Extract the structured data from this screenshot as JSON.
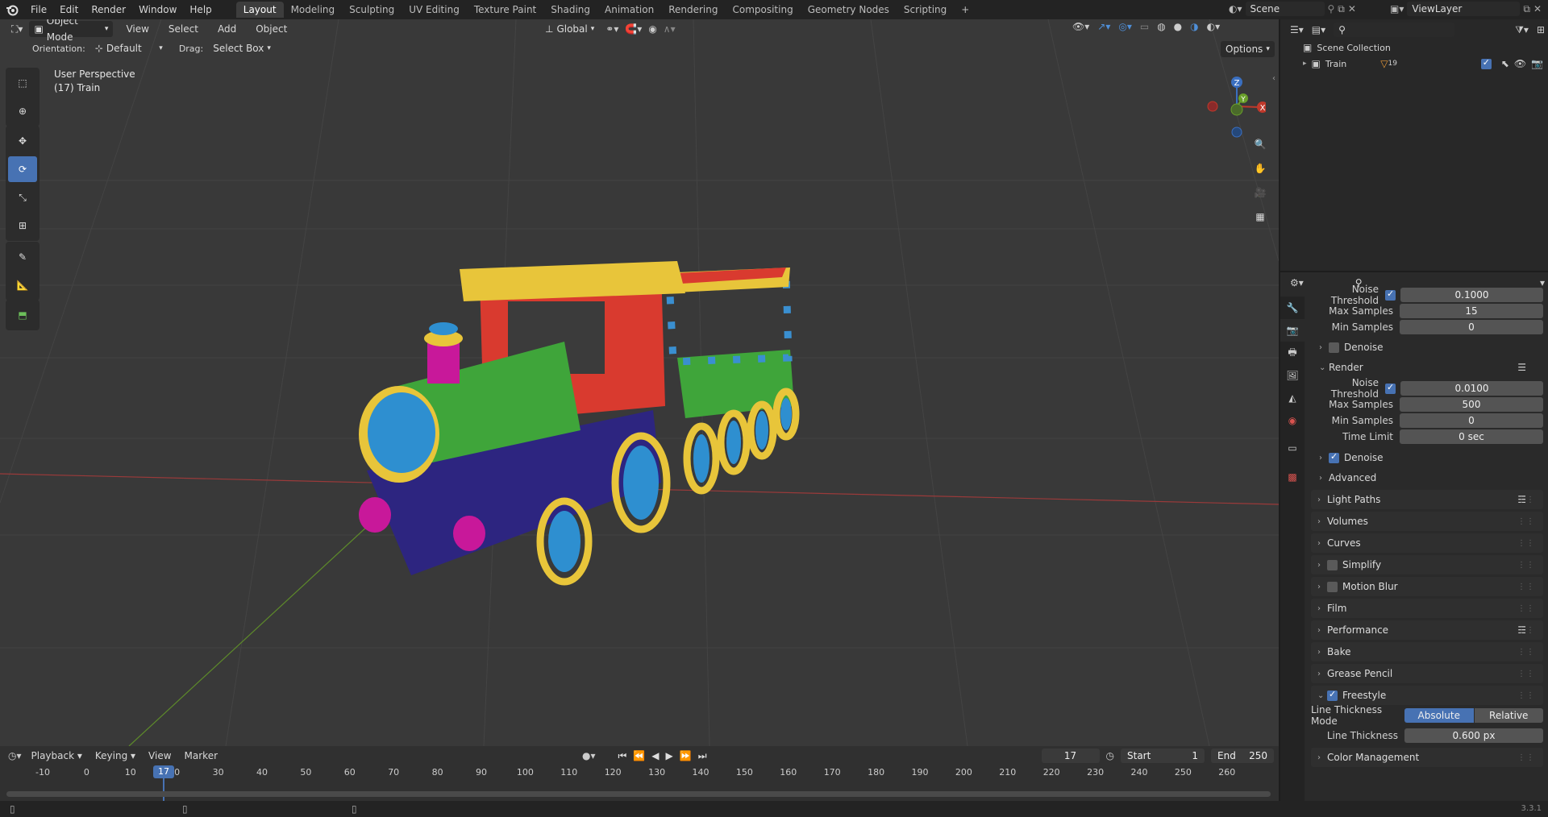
{
  "topbar": {
    "menus": [
      "File",
      "Edit",
      "Render",
      "Window",
      "Help"
    ],
    "workspaces": [
      "Layout",
      "Modeling",
      "Sculpting",
      "UV Editing",
      "Texture Paint",
      "Shading",
      "Animation",
      "Rendering",
      "Compositing",
      "Geometry Nodes",
      "Scripting"
    ],
    "active_workspace": "Layout",
    "add_tab": "+",
    "scene_name": "Scene",
    "view_layer": "ViewLayer"
  },
  "viewport_header": {
    "mode": "Object Mode",
    "menus": [
      "View",
      "Select",
      "Add",
      "Object"
    ],
    "transform_orientation": "Global",
    "orientation_label": "Orientation:",
    "orientation_value": "Default",
    "drag_label": "Drag:",
    "drag_value": "Select Box",
    "options": "Options"
  },
  "viewport": {
    "perspective": "User Perspective",
    "object_info": "(17) Train",
    "gizmo": {
      "z": "Z",
      "y": "Y",
      "x": "X"
    }
  },
  "outliner": {
    "collection": "Scene Collection",
    "item": "Train",
    "item_badge": "19"
  },
  "properties": {
    "viewport_noise_threshold_label": "Noise Threshold",
    "viewport_noise_threshold": "0.1000",
    "viewport_max_samples_label": "Max Samples",
    "viewport_max_samples": "15",
    "viewport_min_samples_label": "Min Samples",
    "viewport_min_samples": "0",
    "denoise1": "Denoise",
    "render_label": "Render",
    "render_noise_threshold_label": "Noise Threshold",
    "render_noise_threshold": "0.0100",
    "render_max_samples_label": "Max Samples",
    "render_max_samples": "500",
    "render_min_samples_label": "Min Samples",
    "render_min_samples": "0",
    "time_limit_label": "Time Limit",
    "time_limit": "0 sec",
    "denoise2": "Denoise",
    "advanced": "Advanced",
    "panels": [
      "Light Paths",
      "Volumes",
      "Curves",
      "Simplify",
      "Motion Blur",
      "Film",
      "Performance",
      "Bake",
      "Grease Pencil",
      "Freestyle",
      "Color Management"
    ],
    "line_thickness_mode_label": "Line Thickness Mode",
    "mode_absolute": "Absolute",
    "mode_relative": "Relative",
    "line_thickness_label": "Line Thickness",
    "line_thickness": "0.600 px"
  },
  "timeline": {
    "menus": [
      "Playback",
      "Keying",
      "View",
      "Marker"
    ],
    "current_frame": "17",
    "start_label": "Start",
    "start": "1",
    "end_label": "End",
    "end": "250",
    "ruler": [
      "-10",
      "0",
      "10",
      "20",
      "30",
      "40",
      "50",
      "60",
      "70",
      "80",
      "90",
      "100",
      "110",
      "120",
      "130",
      "140",
      "150",
      "160",
      "170",
      "180",
      "190",
      "200",
      "210",
      "220",
      "230",
      "240",
      "250",
      "260"
    ],
    "playhead": "17"
  },
  "status": {
    "version": "3.3.1"
  }
}
